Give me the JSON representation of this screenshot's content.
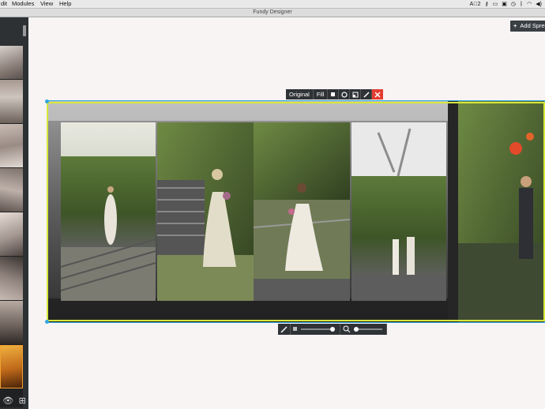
{
  "menubar": {
    "items": [
      "dit",
      "Modules",
      "View",
      "Help"
    ],
    "tray": {
      "badge": "2"
    }
  },
  "window": {
    "title": "Fundy Designer"
  },
  "header": {
    "add_label": "Add Spread"
  },
  "photo_toolbar": {
    "original_label": "Original",
    "fill_label": "Fill"
  },
  "colors": {
    "accent": "#2fa7e0",
    "selection": "#d7e83a",
    "close": "#e43c2f"
  }
}
